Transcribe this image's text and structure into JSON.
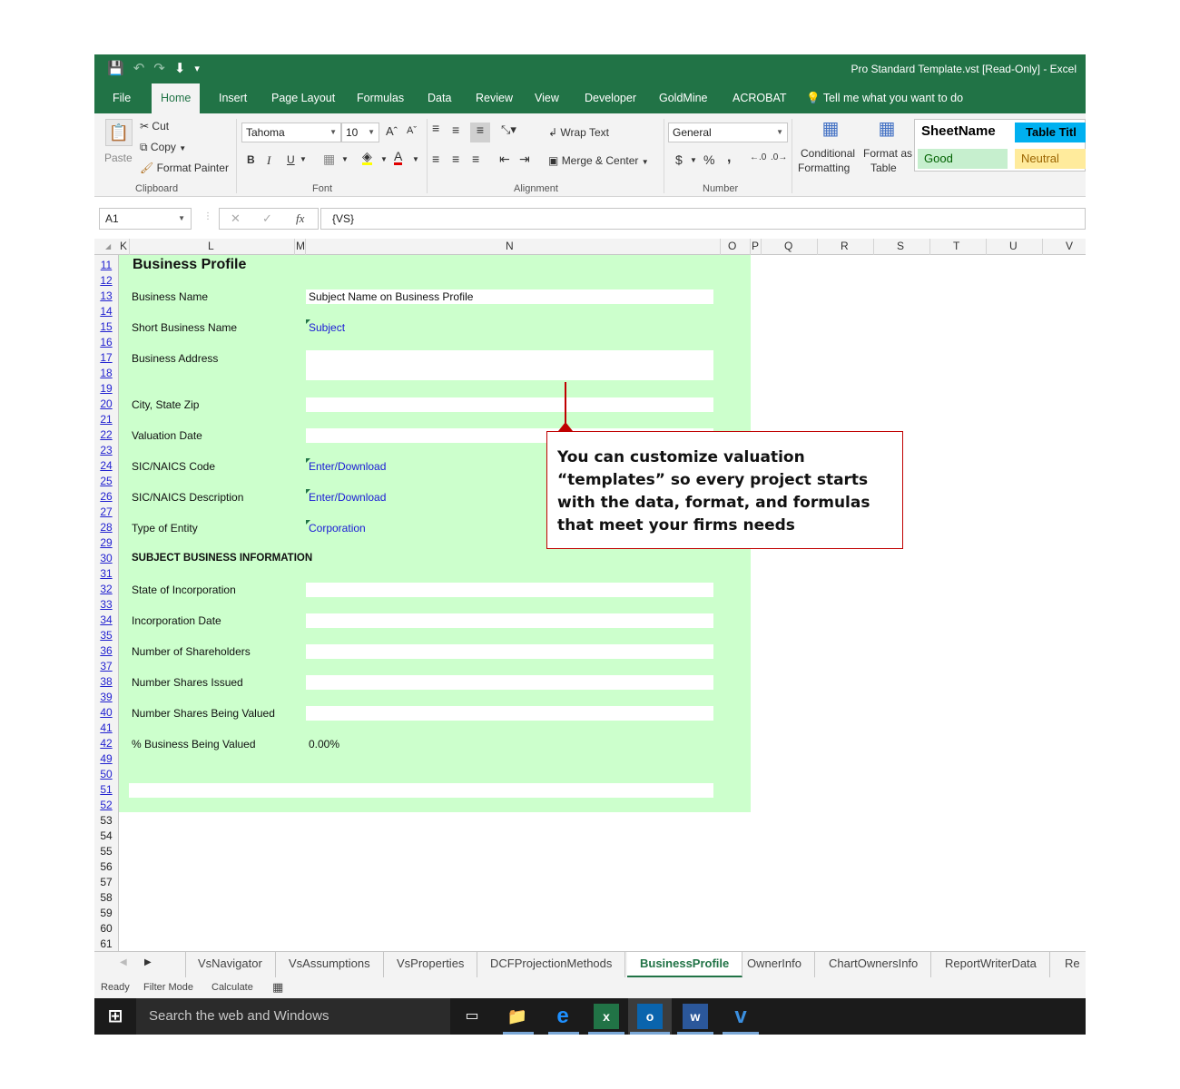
{
  "window": {
    "title": "Pro Standard Template.vst  [Read-Only] - Excel"
  },
  "ribbon_tabs": [
    "File",
    "Home",
    "Insert",
    "Page Layout",
    "Formulas",
    "Data",
    "Review",
    "View",
    "Developer",
    "GoldMine",
    "ACROBAT"
  ],
  "tell_me": "Tell me what you want to do",
  "clipboard": {
    "paste": "Paste",
    "cut": "Cut",
    "copy": "Copy",
    "format_painter": "Format Painter",
    "label": "Clipboard"
  },
  "font": {
    "name": "Tahoma",
    "size": "10",
    "label": "Font",
    "bold": "B",
    "italic": "I",
    "underline": "U"
  },
  "alignment": {
    "wrap_text": "Wrap Text",
    "merge_center": "Merge & Center",
    "label": "Alignment"
  },
  "number": {
    "format": "General",
    "label": "Number",
    "currency": "$",
    "percent": "%",
    "comma": ","
  },
  "styles": {
    "conditional_formatting_1": "Conditional",
    "conditional_formatting_2": "Formatting",
    "format_as_table_1": "Format as",
    "format_as_table_2": "Table",
    "sheetname": "SheetName",
    "table_title": "Table Titl",
    "good": "Good",
    "neutral": "Neutral"
  },
  "formula_bar": {
    "name_box": "A1",
    "formula": "{VS}",
    "fx": "fx"
  },
  "columns": [
    "K",
    "L",
    "M",
    "N",
    "O",
    "P",
    "Q",
    "R",
    "S",
    "T",
    "U",
    "V"
  ],
  "rows": [
    "11",
    "12",
    "13",
    "14",
    "15",
    "16",
    "17",
    "18",
    "19",
    "20",
    "21",
    "22",
    "23",
    "24",
    "25",
    "26",
    "27",
    "28",
    "29",
    "30",
    "31",
    "32",
    "33",
    "34",
    "35",
    "36",
    "37",
    "38",
    "39",
    "40",
    "41",
    "42",
    "49",
    "50",
    "51",
    "52",
    "53",
    "54",
    "55",
    "56",
    "57",
    "58",
    "59",
    "60",
    "61"
  ],
  "profile": {
    "heading": "Business Profile",
    "business_name_label": "Business Name",
    "business_name_value": "Subject Name on Business Profile",
    "short_name_label": "Short Business Name",
    "short_name_value": "Subject",
    "address_label": "Business Address",
    "city_label": "City, State Zip",
    "valuation_date_label": "Valuation Date",
    "sic_code_label": "SIC/NAICS Code",
    "sic_code_value": "Enter/Download",
    "sic_desc_label": "SIC/NAICS Description",
    "sic_desc_value": "Enter/Download",
    "entity_label": "Type of Entity",
    "entity_value": "Corporation",
    "subject_info_heading": "SUBJECT BUSINESS INFORMATION",
    "state_inc_label": "State of Incorporation",
    "inc_date_label": "Incorporation Date",
    "shareholders_label": "Number of Shareholders",
    "shares_issued_label": "Number Shares Issued",
    "shares_valued_label": "Number Shares Being Valued",
    "pct_valued_label": "% Business Being Valued",
    "pct_valued_value": "0.00%"
  },
  "callout": {
    "text": "You can customize valuation “templates” so every project starts with the data, format, and formulas that meet your firms needs"
  },
  "sheet_tabs": [
    "VsNavigator",
    "VsAssumptions",
    "VsProperties",
    "DCFProjectionMethods",
    "BusinessProfile",
    "OwnerInfo",
    "ChartOwnersInfo",
    "ReportWriterData",
    "Re"
  ],
  "active_sheet": "BusinessProfile",
  "status": {
    "ready": "Ready",
    "filter_mode": "Filter Mode",
    "calculate": "Calculate"
  },
  "taskbar": {
    "search_placeholder": "Search the web and Windows"
  },
  "colors": {
    "excel_green": "#217346",
    "sheet_fill": "#ccffcc",
    "callout_border": "#c00000",
    "link_blue": "#1a1ad6"
  }
}
